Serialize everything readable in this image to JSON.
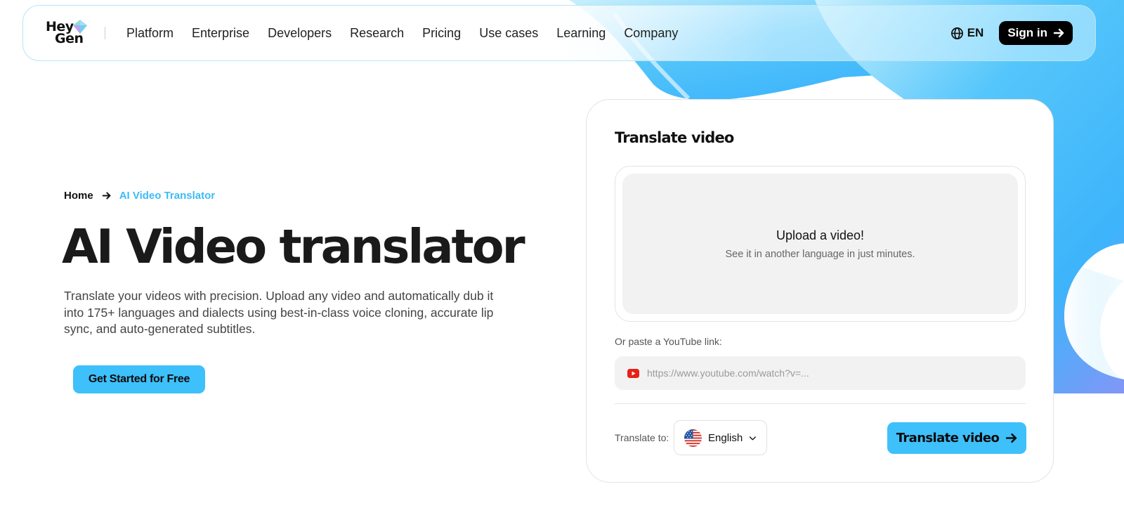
{
  "brand": {
    "logo_line1": "Hey",
    "logo_line2": "Gen"
  },
  "nav": {
    "links": [
      "Platform",
      "Enterprise",
      "Developers",
      "Research",
      "Pricing",
      "Use cases",
      "Learning",
      "Company"
    ],
    "language": "EN",
    "signin_label": "Sign in"
  },
  "breadcrumb": {
    "home": "Home",
    "current": "AI Video Translator"
  },
  "hero": {
    "title": "AI Video translator",
    "description": "Translate your videos with precision. Upload any video and automatically dub it into 175+ languages and dialects using best-in-class voice cloning, accurate lip sync, and auto-generated subtitles.",
    "cta_label": "Get Started for Free"
  },
  "card": {
    "title": "Translate video",
    "upload_title": "Upload a video!",
    "upload_subtitle": "See it in another language in just minutes.",
    "youtube_label": "Or paste a YouTube link:",
    "youtube_placeholder": "https://www.youtube.com/watch?v=...",
    "youtube_value": "",
    "translate_to_label": "Translate to:",
    "selected_language": "English",
    "translate_button_label": "Translate video"
  },
  "colors": {
    "accent": "#3ec0fb",
    "breadcrumb_active": "#3bbcf6",
    "dark": "#000000"
  },
  "icons": {
    "language": "globe-icon",
    "signin": "arrow-right-icon",
    "breadcrumb_separator": "arrow-right-icon",
    "youtube": "youtube-icon",
    "flag": "us-flag-icon",
    "dropdown": "chevron-down-icon",
    "translate": "arrow-right-icon"
  }
}
